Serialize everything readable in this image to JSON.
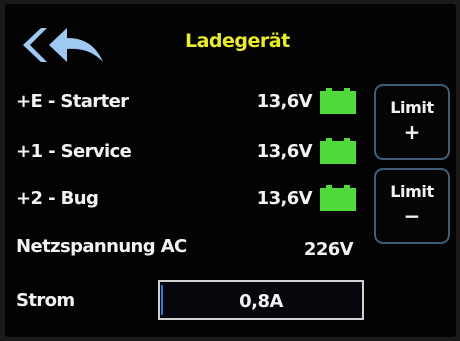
{
  "header": {
    "title": "Ladegerät",
    "back_icon": "double-back-arrow-icon"
  },
  "channels": [
    {
      "label": "+E  - Starter",
      "voltage": "13,6V",
      "battery_color": "#4fd93a"
    },
    {
      "label": "+1  - Service",
      "voltage": "13,6V",
      "battery_color": "#4fd93a"
    },
    {
      "label": "+2  - Bug",
      "voltage": "13,6V",
      "battery_color": "#4fd93a"
    }
  ],
  "mains": {
    "label": "Netzspannung  AC",
    "value": "226V"
  },
  "current": {
    "label": "Strom",
    "value": "0,8A"
  },
  "limit_buttons": {
    "plus": {
      "label": "Limit",
      "symbol": "+"
    },
    "minus": {
      "label": "Limit",
      "symbol": "−"
    }
  },
  "colors": {
    "accent_title": "#e8ec2a",
    "button_border": "#3e5d7a",
    "text": "#f2f2f2"
  }
}
